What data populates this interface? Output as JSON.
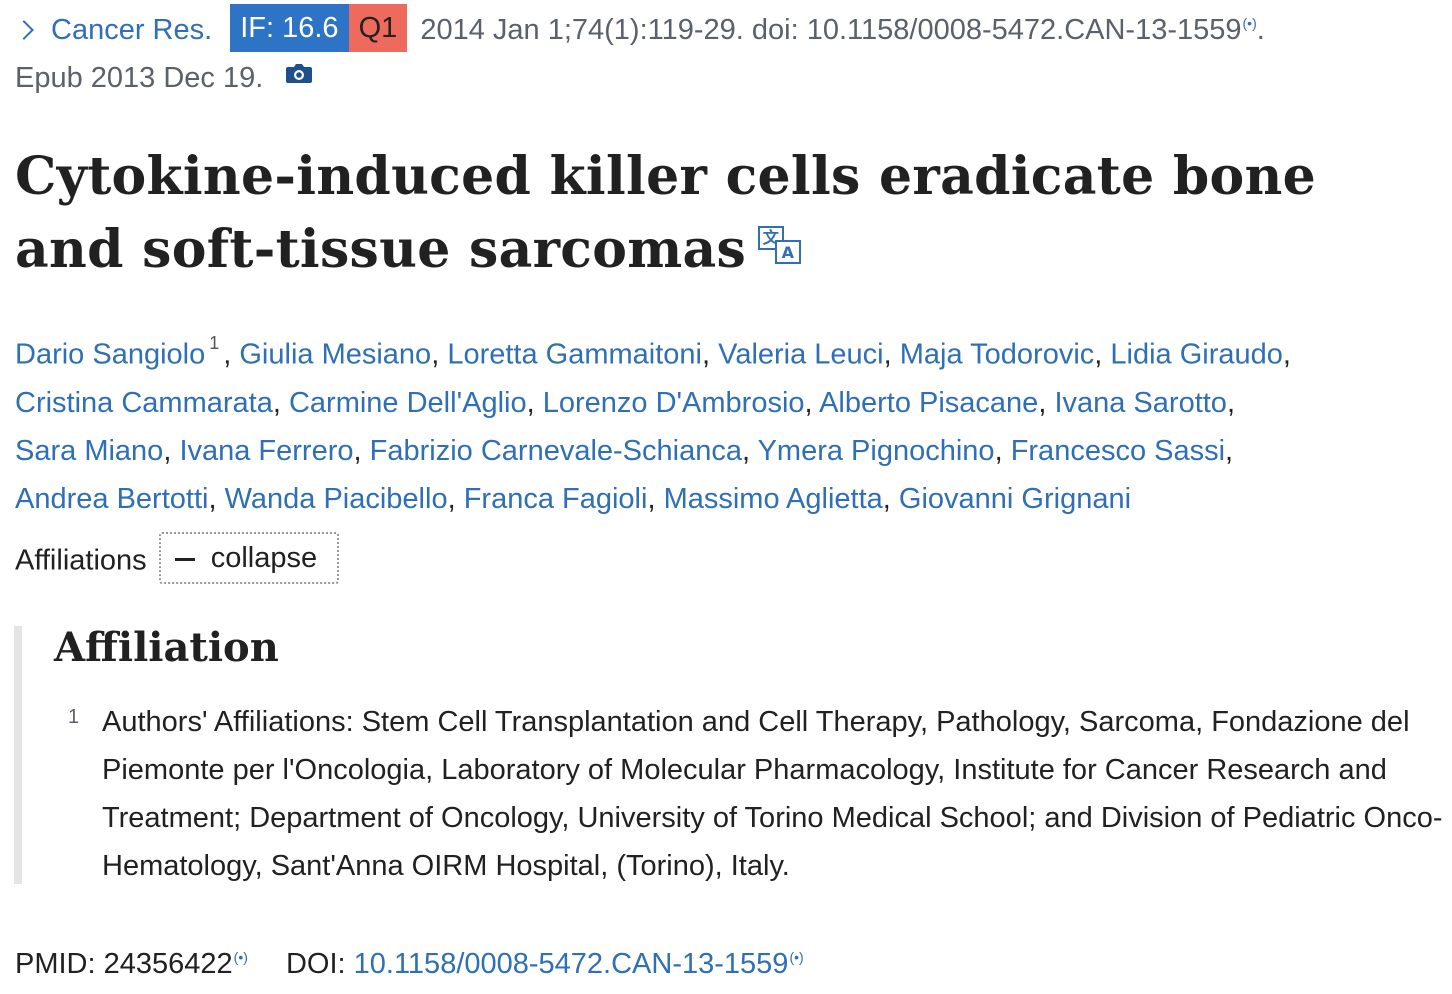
{
  "citation": {
    "journal": "Cancer Res.",
    "impact_factor": "IF: 16.6",
    "quartile": "Q1",
    "details": "2014 Jan 1;74(1):119-29. doi: 10.1158/0008-5472.CAN-13-1559",
    "trailing": ".",
    "epub": "Epub 2013 Dec 19."
  },
  "title": "Cytokine-induced killer cells eradicate bone and soft-tissue sarcomas",
  "authors": [
    "Dario Sangiolo",
    "Giulia Mesiano",
    "Loretta Gammaitoni",
    "Valeria Leuci",
    "Maja Todorovic",
    "Lidia Giraudo",
    "Cristina Cammarata",
    "Carmine Dell'Aglio",
    "Lorenzo D'Ambrosio",
    "Alberto Pisacane",
    "Ivana Sarotto",
    "Sara Miano",
    "Ivana Ferrero",
    "Fabrizio Carnevale-Schianca",
    "Ymera Pignochino",
    "Francesco Sassi",
    "Andrea Bertotti",
    "Wanda Piacibello",
    "Franca Fagioli",
    "Massimo Aglietta",
    "Giovanni Grignani"
  ],
  "first_author_affiliation_ref": "1",
  "affiliations_toggle": {
    "label": "Affiliations",
    "button_label": "collapse"
  },
  "affiliation_section": {
    "heading": "Affiliation",
    "items": [
      {
        "number": "1",
        "text": "Authors' Affiliations: Stem Cell Transplantation and Cell Therapy, Pathology, Sarcoma, Fondazione del Piemonte per l'Oncologia, Laboratory of Molecular Pharmacology, Institute for Cancer Research and Treatment; Department of Oncology, University of Torino Medical School; and Division of Pediatric Onco-Hematology, Sant'Anna OIRM Hospital, (Torino), Italy."
      }
    ]
  },
  "identifiers": {
    "pmid_label": "PMID:",
    "pmid": "24356422",
    "doi_label": "DOI:",
    "doi": "10.1158/0008-5472.CAN-13-1559"
  },
  "colors": {
    "link": "#2f6fb5",
    "if_badge": "#2d74c7",
    "quartile_badge": "#ee6a5d"
  },
  "icons": [
    "chevron-right-icon",
    "citation-radio-icon",
    "camera-icon",
    "translate-icon"
  ]
}
